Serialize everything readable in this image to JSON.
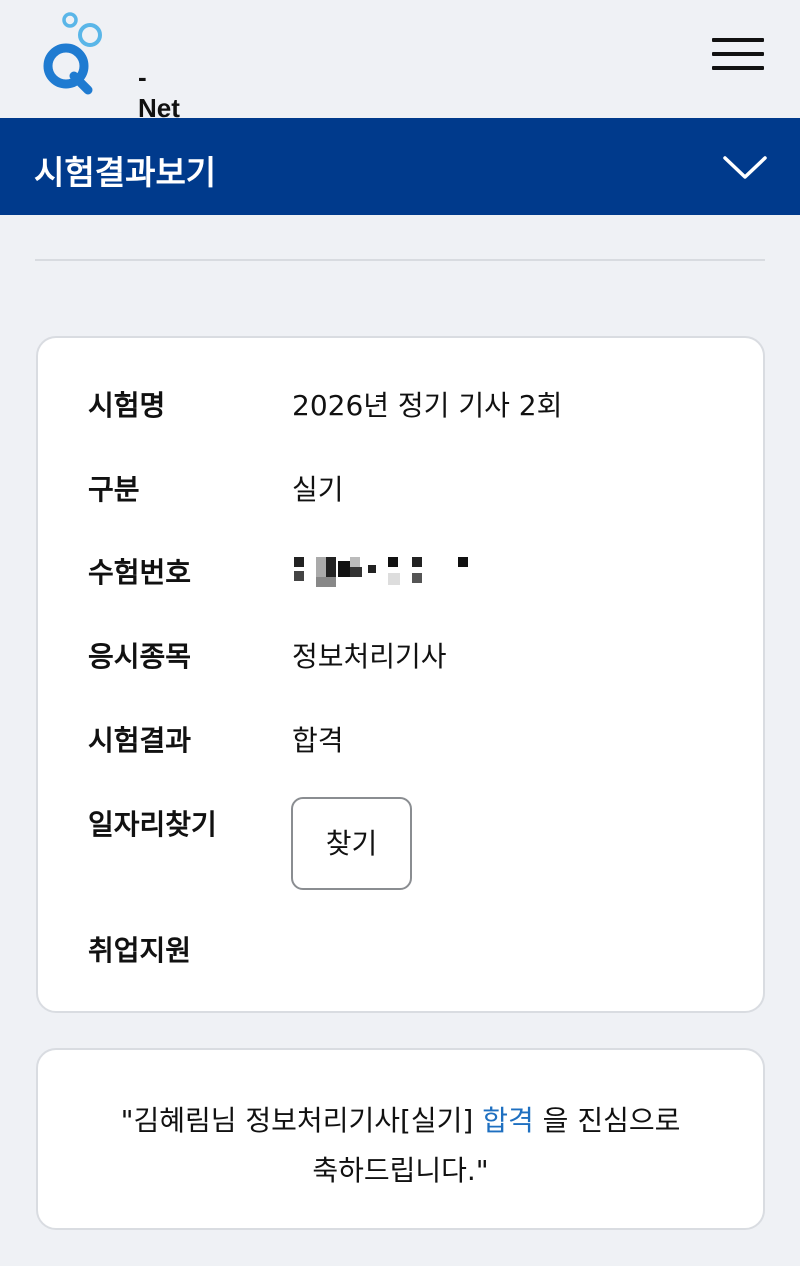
{
  "brand": {
    "logo_text": "- Net",
    "colors": {
      "primary": "#003a8c",
      "accent": "#1e6fc0",
      "logo_blue": "#1f7bd1",
      "logo_light": "#5ab6e8"
    }
  },
  "header": {
    "menu_icon": "hamburger-menu-icon"
  },
  "nav": {
    "title": "시험결과보기",
    "toggle_icon": "chevron-down-icon"
  },
  "result": {
    "rows": [
      {
        "label": "시험명",
        "value": "2026년 정기 기사 2회"
      },
      {
        "label": "구분",
        "value": "실기"
      },
      {
        "label": "수험번호",
        "value": ""
      },
      {
        "label": "응시종목",
        "value": "정보처리기사"
      },
      {
        "label": "시험결과",
        "value": "합격"
      },
      {
        "label": "일자리찾기",
        "value": ""
      },
      {
        "label": "취업지원",
        "value": ""
      }
    ],
    "find_button": "찾기"
  },
  "message": {
    "line1_prefix": "\"김혜림님 정보처리기사[실기] ",
    "highlight": "합격",
    "line1_suffix": " 을 진심으로",
    "line2": "축하드립니다.\""
  }
}
